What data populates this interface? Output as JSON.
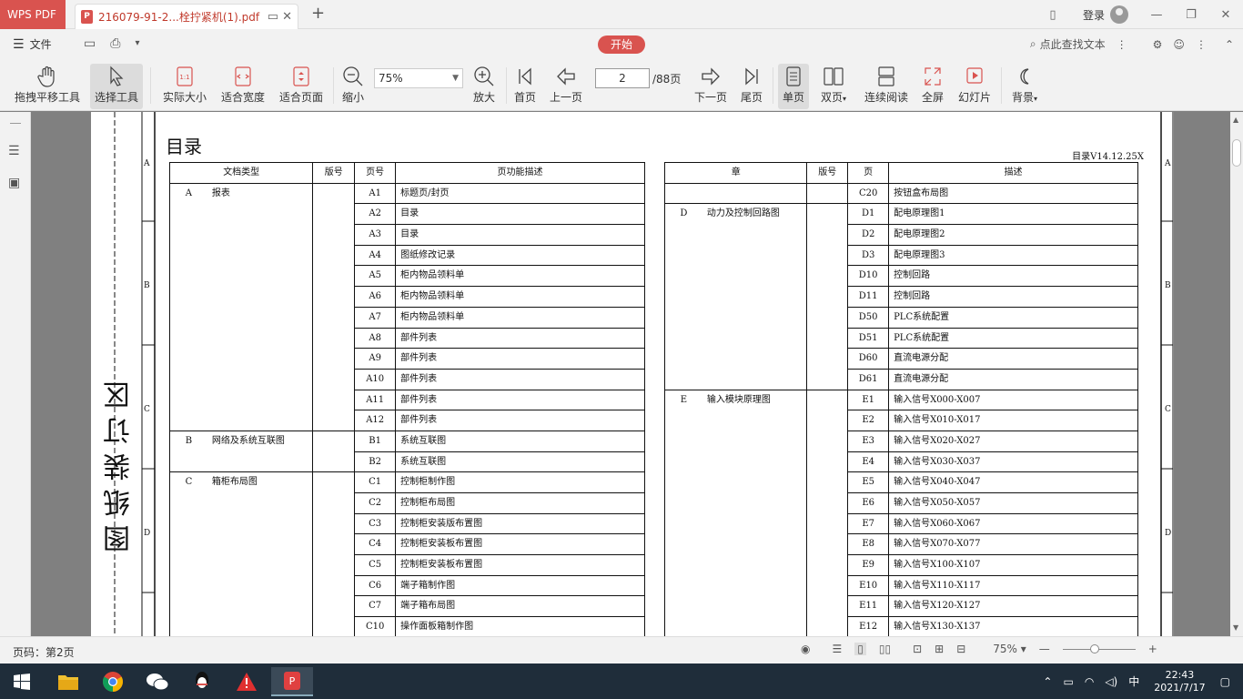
{
  "app": {
    "name": "WPS PDF",
    "doc_tab": "216079-91-2...栓拧紧机(1).pdf",
    "login": "登录"
  },
  "menu": {
    "file": "文件",
    "start": "开始",
    "search": "点此查找文本"
  },
  "toolbar": {
    "pan": "拖拽平移工具",
    "select": "选择工具",
    "actual": "实际大小",
    "fit_width": "适合宽度",
    "fit_page": "适合页面",
    "zoom_out": "缩小",
    "zoom_value": "75%",
    "zoom_in": "放大",
    "first": "首页",
    "prev": "上一页",
    "page_value": "2",
    "page_total": "/88页",
    "next": "下一页",
    "last": "尾页",
    "single": "单页",
    "double": "双页",
    "continuous": "连续阅读",
    "fullscreen": "全屏",
    "slideshow": "幻灯片",
    "background": "背景"
  },
  "document": {
    "title": "目录",
    "version": "目录V14.12.25X",
    "binding": "图 纸 装 订 区",
    "row_marks": [
      "A",
      "B",
      "C",
      "D"
    ],
    "left_headers": [
      "文档类型",
      "版号",
      "页号",
      "页功能描述"
    ],
    "left_rows": [
      [
        "A",
        "报表",
        "",
        "A1",
        "标题页/封页"
      ],
      [
        "",
        "",
        "",
        "A2",
        "目录"
      ],
      [
        "",
        "",
        "",
        "A3",
        "目录"
      ],
      [
        "",
        "",
        "",
        "A4",
        "图纸修改记录"
      ],
      [
        "",
        "",
        "",
        "A5",
        "柜内物品领料单"
      ],
      [
        "",
        "",
        "",
        "A6",
        "柜内物品领料单"
      ],
      [
        "",
        "",
        "",
        "A7",
        "柜内物品领料单"
      ],
      [
        "",
        "",
        "",
        "A8",
        "部件列表"
      ],
      [
        "",
        "",
        "",
        "A9",
        "部件列表"
      ],
      [
        "",
        "",
        "",
        "A10",
        "部件列表"
      ],
      [
        "",
        "",
        "",
        "A11",
        "部件列表"
      ],
      [
        "",
        "",
        "",
        "A12",
        "部件列表"
      ],
      [
        "B",
        "网络及系统互联图",
        "",
        "B1",
        "系统互联图"
      ],
      [
        "",
        "",
        "",
        "B2",
        "系统互联图"
      ],
      [
        "C",
        "箱柜布局图",
        "",
        "C1",
        "控制柜制作图"
      ],
      [
        "",
        "",
        "",
        "C2",
        "控制柜布局图"
      ],
      [
        "",
        "",
        "",
        "C3",
        "控制柜安装版布置图"
      ],
      [
        "",
        "",
        "",
        "C4",
        "控制柜安装板布置图"
      ],
      [
        "",
        "",
        "",
        "C5",
        "控制柜安装板布置图"
      ],
      [
        "",
        "",
        "",
        "C6",
        "端子箱制作图"
      ],
      [
        "",
        "",
        "",
        "C7",
        "端子箱布局图"
      ],
      [
        "",
        "",
        "",
        "C10",
        "操作面板箱制作图"
      ]
    ],
    "right_headers": [
      "章",
      "版号",
      "页",
      "描述"
    ],
    "right_rows": [
      [
        "",
        "",
        "",
        "C20",
        "按钮盒布局图"
      ],
      [
        "D",
        "动力及控制回路图",
        "",
        "D1",
        "配电原理图1"
      ],
      [
        "",
        "",
        "",
        "D2",
        "配电原理图2"
      ],
      [
        "",
        "",
        "",
        "D3",
        "配电原理图3"
      ],
      [
        "",
        "",
        "",
        "D10",
        "控制回路"
      ],
      [
        "",
        "",
        "",
        "D11",
        "控制回路"
      ],
      [
        "",
        "",
        "",
        "D50",
        "PLC系统配置"
      ],
      [
        "",
        "",
        "",
        "D51",
        "PLC系统配置"
      ],
      [
        "",
        "",
        "",
        "D60",
        "直流电源分配"
      ],
      [
        "",
        "",
        "",
        "D61",
        "直流电源分配"
      ],
      [
        "E",
        "输入模块原理图",
        "",
        "E1",
        "输入信号X000-X007"
      ],
      [
        "",
        "",
        "",
        "E2",
        "输入信号X010-X017"
      ],
      [
        "",
        "",
        "",
        "E3",
        "输入信号X020-X027"
      ],
      [
        "",
        "",
        "",
        "E4",
        "输入信号X030-X037"
      ],
      [
        "",
        "",
        "",
        "E5",
        "输入信号X040-X047"
      ],
      [
        "",
        "",
        "",
        "E6",
        "输入信号X050-X057"
      ],
      [
        "",
        "",
        "",
        "E7",
        "输入信号X060-X067"
      ],
      [
        "",
        "",
        "",
        "E8",
        "输入信号X070-X077"
      ],
      [
        "",
        "",
        "",
        "E9",
        "输入信号X100-X107"
      ],
      [
        "",
        "",
        "",
        "E10",
        "输入信号X110-X117"
      ],
      [
        "",
        "",
        "",
        "E11",
        "输入信号X120-X127"
      ],
      [
        "",
        "",
        "",
        "E12",
        "输入信号X130-X137"
      ]
    ]
  },
  "status": {
    "page_label": "页码：第2页",
    "zoom": "75%"
  },
  "taskbar": {
    "time": "22:43",
    "date": "2021/7/17",
    "ime": "中"
  }
}
